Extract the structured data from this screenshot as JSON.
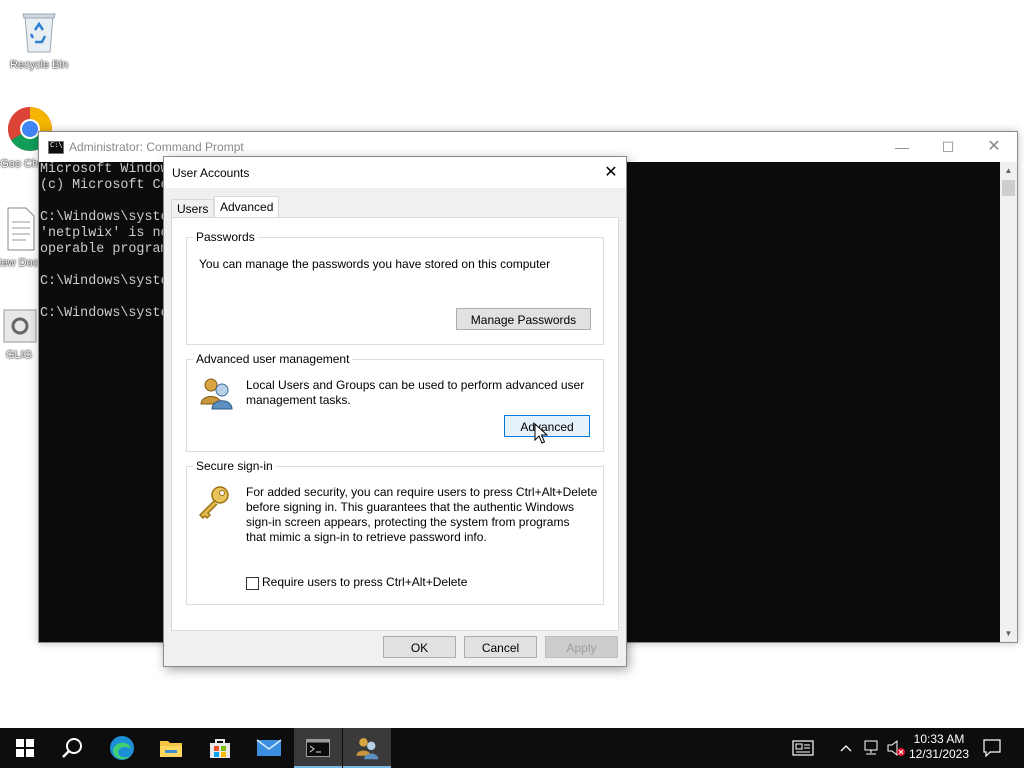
{
  "desktop": {
    "icons": [
      {
        "label": "Recycle Bin"
      },
      {
        "label": "Goo Chr"
      },
      {
        "label": "New Docu"
      },
      {
        "label": "GLIG"
      }
    ]
  },
  "cmd": {
    "title": "Administrator: Command Prompt",
    "lines": [
      "Microsoft Window",
      "(c) Microsoft Co",
      "",
      "C:\\Windows\\syste",
      "'netplwix' is no",
      "operable program",
      "",
      "C:\\Windows\\syste",
      "",
      "C:\\Windows\\syste"
    ]
  },
  "dialog": {
    "title": "User Accounts",
    "tabs": [
      {
        "label": "Users"
      },
      {
        "label": "Advanced"
      }
    ],
    "passwords": {
      "heading": "Passwords",
      "text": "You can manage the passwords you have stored on this computer",
      "button": "Manage Passwords"
    },
    "advanced_mgmt": {
      "heading": "Advanced user management",
      "text_line1": "Local Users and Groups can be used to perform advanced user",
      "text_line2": "management tasks.",
      "button": "Advanced"
    },
    "secure_signin": {
      "heading": "Secure sign-in",
      "text_line1": "For added security, you can require users to press Ctrl+Alt+Delete",
      "text_line2": "before signing in. This guarantees that the authentic Windows",
      "text_line3": "sign-in screen appears, protecting the system from programs",
      "text_line4": "that mimic a sign-in to retrieve password info.",
      "checkbox_label": "Require users to press Ctrl+Alt+Delete",
      "checkbox_checked": false
    },
    "buttons": {
      "ok": "OK",
      "cancel": "Cancel",
      "apply": "Apply"
    }
  },
  "taskbar": {
    "clock_time": "10:33 AM",
    "clock_date": "12/31/2023",
    "accent": "#7ab8e6"
  }
}
